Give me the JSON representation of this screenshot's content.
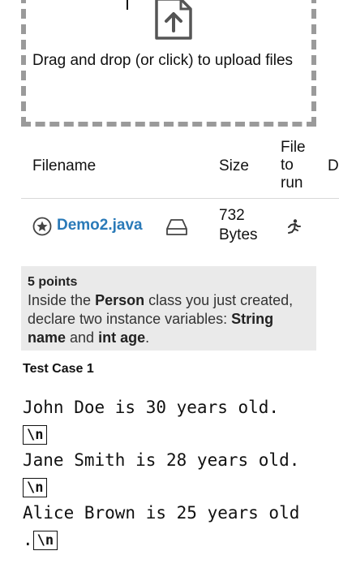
{
  "upload": {
    "instruction": "Drag and drop (or click) to upload files",
    "icon": "file-upload-icon"
  },
  "table": {
    "headers": {
      "filename": "Filename",
      "size": "Size",
      "file_to_run": "File to run",
      "d": "D"
    },
    "rows": [
      {
        "filename": "Demo2.java",
        "size": "732 Bytes",
        "icons": [
          "star-circle-icon",
          "drive-icon",
          "running-person-icon"
        ]
      }
    ]
  },
  "instruction": {
    "points": "5 points",
    "text_before": "Inside the ",
    "class_name": "Person",
    "text_middle": " class you just created, declare two instance variables: ",
    "var1": "String name",
    "text_and": " and ",
    "var2": "int age",
    "text_end": "."
  },
  "test_case": {
    "title": "Test Case 1",
    "lines": [
      "John Doe is 30 years old.",
      "Jane Smith is 28 years old.",
      "Alice Brown is 25 years old"
    ],
    "line3_tail": ".",
    "newline_badge": "\\n"
  },
  "colors": {
    "link": "#2a7ab8",
    "instruction_bg": "#eaeaea",
    "dashed_border": "#9a9a9a"
  }
}
